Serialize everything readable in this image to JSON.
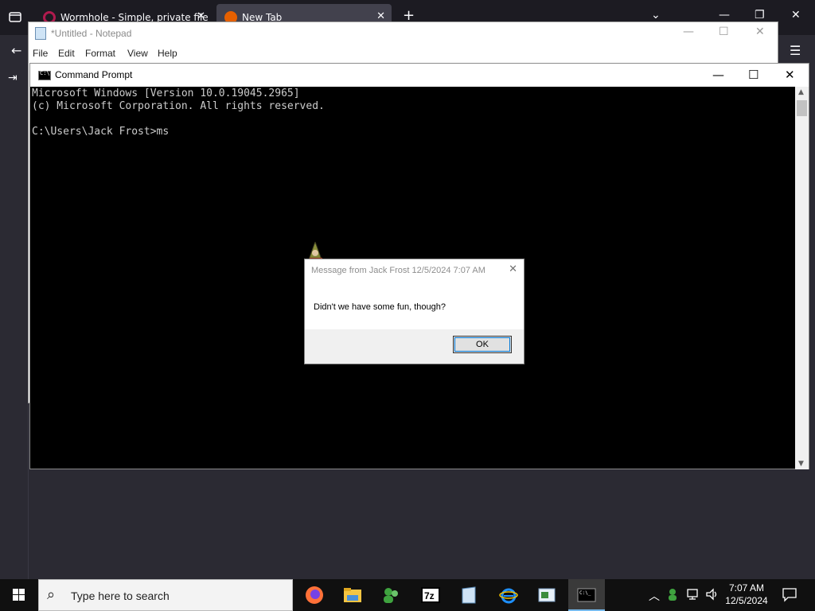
{
  "firefox": {
    "tabs": [
      {
        "label": "Wormhole - Simple, private file"
      },
      {
        "label": "New Tab"
      }
    ],
    "new_tab_label": "+"
  },
  "notepad": {
    "title": "*Untitled - Notepad",
    "menu": [
      "File",
      "Edit",
      "Format",
      "View",
      "Help"
    ]
  },
  "cmd": {
    "title": "Command Prompt",
    "lines": [
      "Microsoft Windows [Version 10.0.19045.2965]",
      "(c) Microsoft Corporation. All rights reserved.",
      "",
      "C:\\Users\\Jack Frost>ms"
    ]
  },
  "message_box": {
    "title": "Message from Jack Frost 12/5/2024 7:07 AM",
    "text": "Didn't we have some fun, though?",
    "ok_label": "OK"
  },
  "taskbar": {
    "search_placeholder": "Type here to search",
    "apps": [
      "firefox-icon",
      "file-explorer-icon",
      "chat-users-icon",
      "7zip-icon",
      "notepad-icon",
      "internet-explorer-icon",
      "control-panel-icon",
      "command-prompt-icon"
    ],
    "time": "7:07 AM",
    "date": "12/5/2024"
  }
}
